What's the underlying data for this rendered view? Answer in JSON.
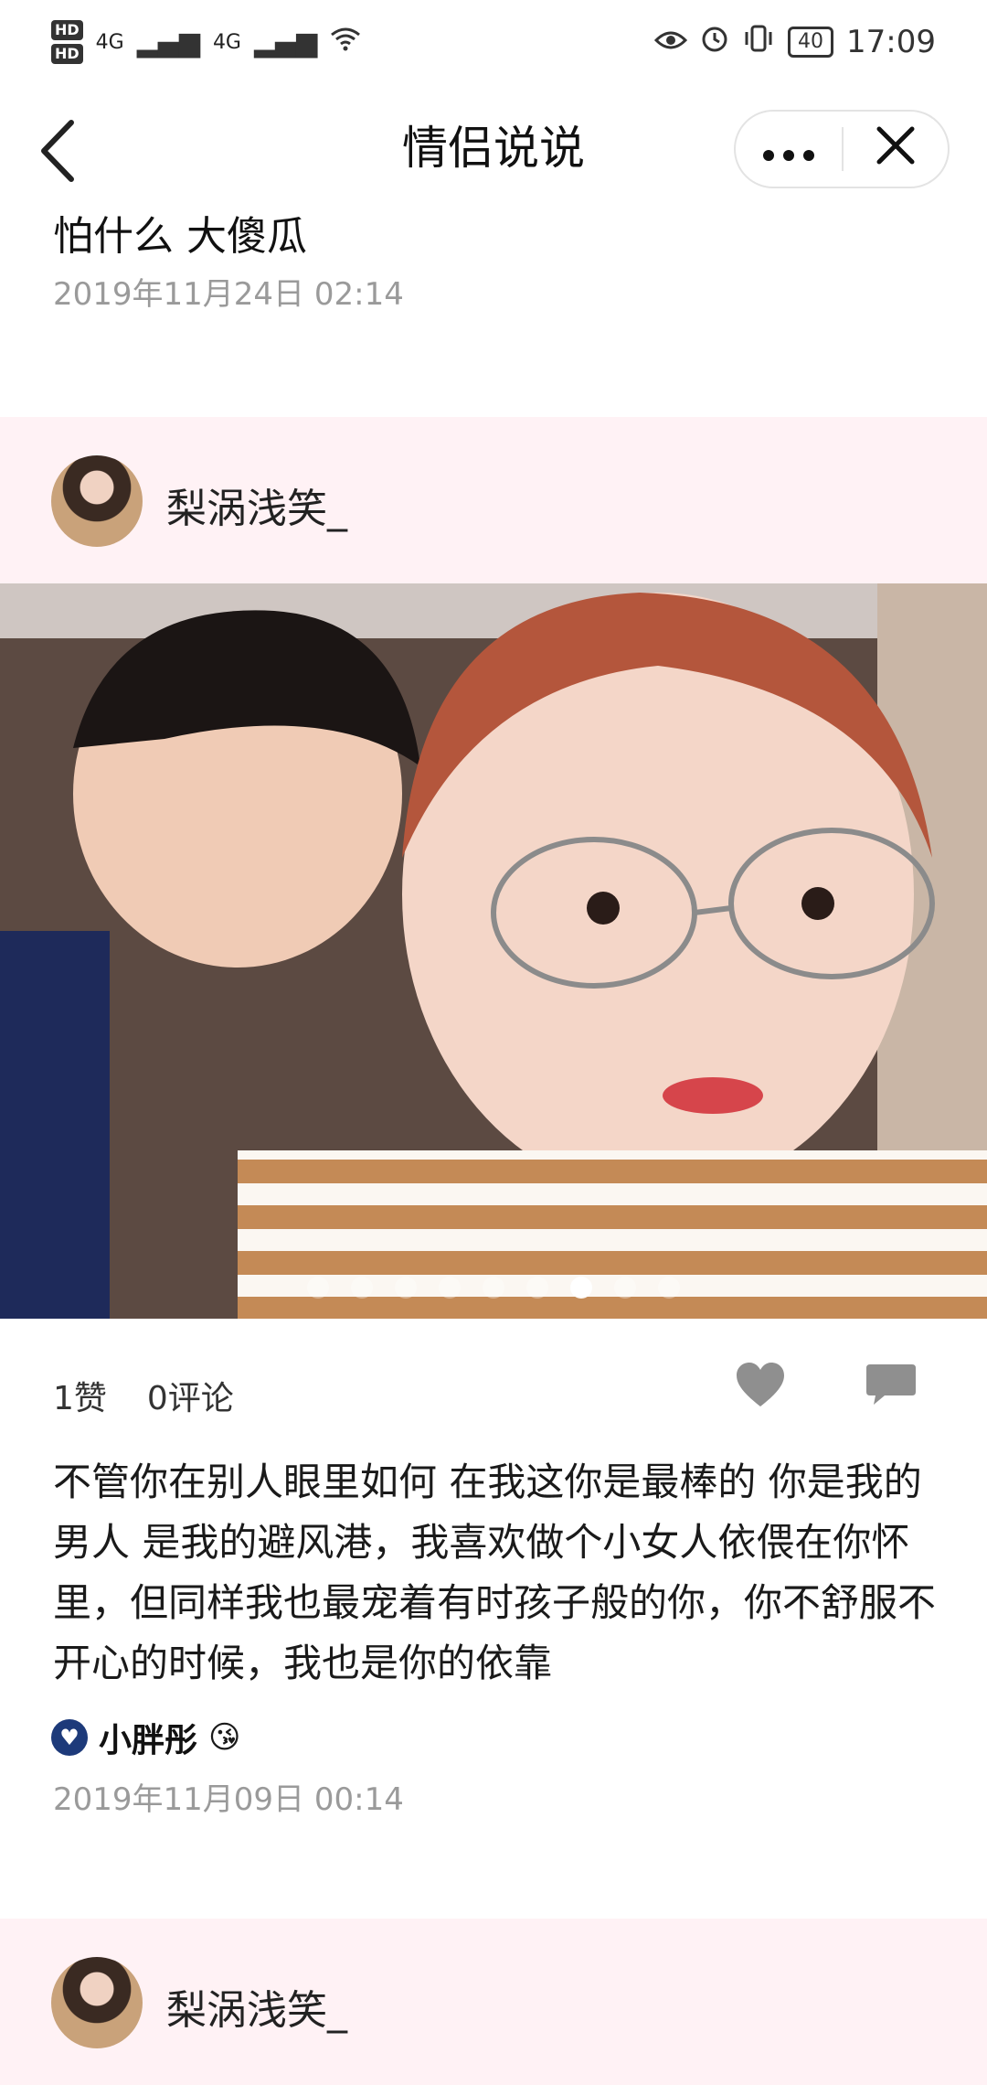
{
  "status_bar": {
    "hd1": "HD",
    "hd2": "HD",
    "signal1": "4G",
    "signal2": "4G",
    "battery": "40",
    "time": "17:09"
  },
  "nav": {
    "title": "情侣说说",
    "back_icon": "back-arrow-icon",
    "more_icon": "more-dots-icon",
    "close_icon": "close-icon"
  },
  "previous_post": {
    "text": "怕什么 大傻瓜",
    "time": "2019年11月24日 02:14"
  },
  "post": {
    "author": "梨涡浅笑_",
    "photo_count": 9,
    "active_photo_index": 6,
    "likes_label": "1赞",
    "comments_label": "0评论",
    "body": "不管你在别人眼里如何 在我这你是最棒的 你是我的男人 是我的避风港，我喜欢做个小女人依偎在你怀里，但同样我也最宠着有时孩子般的你，你不舒服不开心的时候，我也是你的依靠",
    "liker_name": "小胖彤",
    "liker_emoji": "😘",
    "time": "2019年11月09日 00:14"
  },
  "next_post": {
    "author": "梨涡浅笑_"
  }
}
